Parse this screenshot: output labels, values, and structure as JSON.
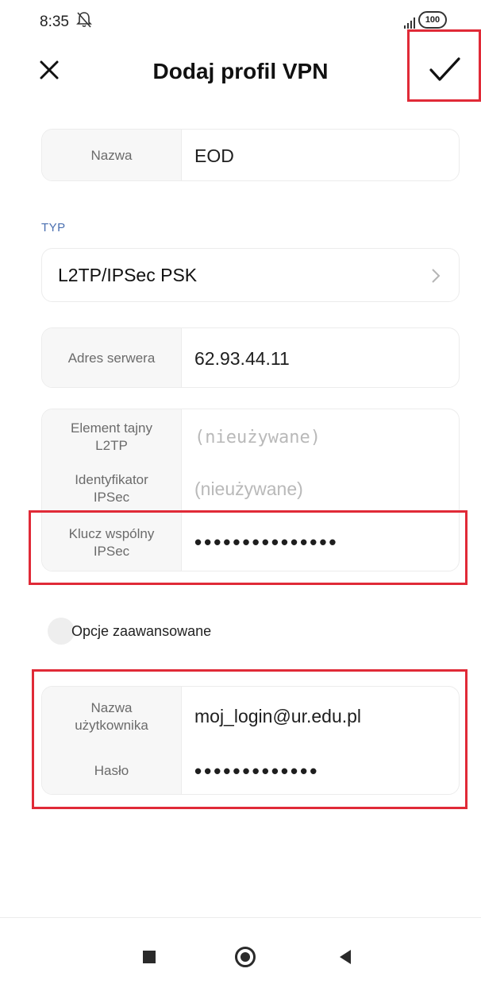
{
  "status_bar": {
    "time": "8:35",
    "battery": "100",
    "icons": [
      "bell-off-icon",
      "signal-icon",
      "battery-icon"
    ]
  },
  "header": {
    "title": "Dodaj profil VPN",
    "close_icon": "close-icon",
    "confirm_icon": "checkmark-icon"
  },
  "name_field": {
    "label": "Nazwa",
    "value": "EOD"
  },
  "type_section": {
    "label": "TYP",
    "value": "L2TP/IPSec PSK",
    "icon": "chevron-right-icon"
  },
  "server_field": {
    "label": "Adres serwera",
    "value": "62.93.44.11"
  },
  "ipsec_card": {
    "l2tp_secret": {
      "label_line1": "Element tajny",
      "label_line2": "L2TP",
      "placeholder": "(nieużywane)"
    },
    "ipsec_id": {
      "label_line1": "Identyfikator",
      "label_line2": "IPSec",
      "placeholder": "(nieużywane)"
    },
    "psk": {
      "label_line1": "Klucz wspólny",
      "label_line2": "IPSec",
      "value": "•••••••••••••••"
    }
  },
  "advanced": {
    "label": "Opcje zaawansowane"
  },
  "credentials_card": {
    "username": {
      "label_line1": "Nazwa",
      "label_line2": "użytkownika",
      "value": "moj_login@ur.edu.pl"
    },
    "password": {
      "label": "Hasło",
      "value": "•••••••••••••"
    }
  },
  "nav_bar": {
    "buttons": [
      "recents-square-icon",
      "home-circle-icon",
      "back-triangle-icon"
    ]
  },
  "colors": {
    "highlight": "#e02a37",
    "section_label": "#4a6fb0",
    "label_bg": "#f7f7f7"
  }
}
